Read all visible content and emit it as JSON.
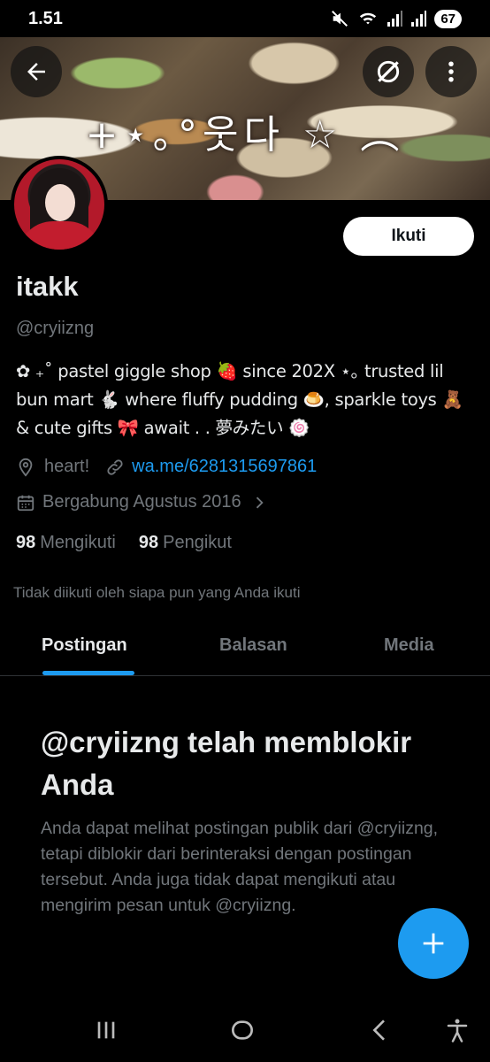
{
  "status_bar": {
    "time": "1.51",
    "battery": "67",
    "icons": [
      "mute-icon",
      "wifi-icon",
      "signal-icon",
      "signal-icon"
    ]
  },
  "banner": {
    "title": "+⋆｡°웃다 ☆ ︵"
  },
  "profile": {
    "follow_label": "Ikuti",
    "display_name": "itakk",
    "handle": "@cryiizng",
    "bio_lines": [
      "✿ ₊˚ pastel giggle shop 🍓 since 202X ⋆｡ trusted lil",
      "bun mart 🐇 where fluffy pudding 🍮, sparkle toys 🧸",
      "& cute gifts 🎀 await . . 夢みたい 🍥"
    ],
    "location": "heart!",
    "link": "wa.me/6281315697861",
    "joined": "Bergabung Agustus 2016",
    "following_count": "98",
    "following_label": "Mengikuti",
    "followers_count": "98",
    "followers_label": "Pengikut",
    "not_followed_text": "Tidak diikuti oleh siapa pun yang Anda ikuti"
  },
  "tabs": [
    {
      "label": "Postingan",
      "active": true
    },
    {
      "label": "Balasan",
      "active": false
    },
    {
      "label": "Media",
      "active": false
    }
  ],
  "blocked": {
    "title": "@cryiizng telah memblokir Anda",
    "body": "Anda dapat melihat postingan publik dari @cryiizng, tetapi diblokir dari berinteraksi dengan postingan tersebut. Anda juga tidak dapat mengikuti atau mengirim pesan untuk @cryiizng."
  },
  "colors": {
    "accent": "#1d9bf0",
    "background": "#000000",
    "text_primary": "#e7e9ea",
    "text_secondary": "#71767b"
  }
}
